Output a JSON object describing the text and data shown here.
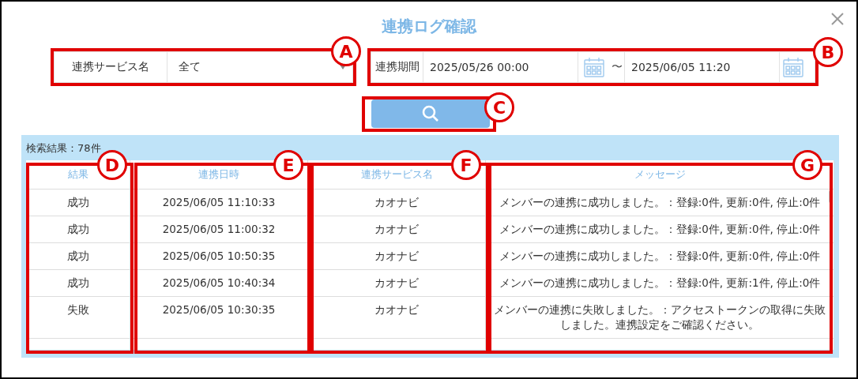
{
  "dialog": {
    "title": "連携ログ確認"
  },
  "filters": {
    "service": {
      "label": "連携サービス名",
      "value": "全て"
    },
    "period": {
      "label": "連携期間",
      "from": "2025/05/26 00:00",
      "separator": "〜",
      "to": "2025/06/05 11:20"
    }
  },
  "results": {
    "count_label": "検索結果：78件",
    "columns": [
      "結果",
      "連携日時",
      "連携サービス名",
      "メッセージ"
    ],
    "rows": [
      {
        "result": "成功",
        "datetime": "2025/06/05 11:10:33",
        "service": "カオナビ",
        "message": "メンバーの連携に成功しました。：登録:0件, 更新:0件, 停止:0件"
      },
      {
        "result": "成功",
        "datetime": "2025/06/05 11:00:32",
        "service": "カオナビ",
        "message": "メンバーの連携に成功しました。：登録:0件, 更新:0件, 停止:0件"
      },
      {
        "result": "成功",
        "datetime": "2025/06/05 10:50:35",
        "service": "カオナビ",
        "message": "メンバーの連携に成功しました。：登録:0件, 更新:0件, 停止:0件"
      },
      {
        "result": "成功",
        "datetime": "2025/06/05 10:40:34",
        "service": "カオナビ",
        "message": "メンバーの連携に成功しました。：登録:0件, 更新:1件, 停止:0件"
      },
      {
        "result": "失敗",
        "datetime": "2025/06/05 10:30:35",
        "service": "カオナビ",
        "message": "メンバーの連携に失敗しました。：アクセストークンの取得に失敗しました。連携設定をご確認ください。"
      }
    ]
  },
  "annotations": [
    {
      "label": "A"
    },
    {
      "label": "B"
    },
    {
      "label": "C"
    },
    {
      "label": "D"
    },
    {
      "label": "E"
    },
    {
      "label": "F"
    },
    {
      "label": "G"
    }
  ]
}
